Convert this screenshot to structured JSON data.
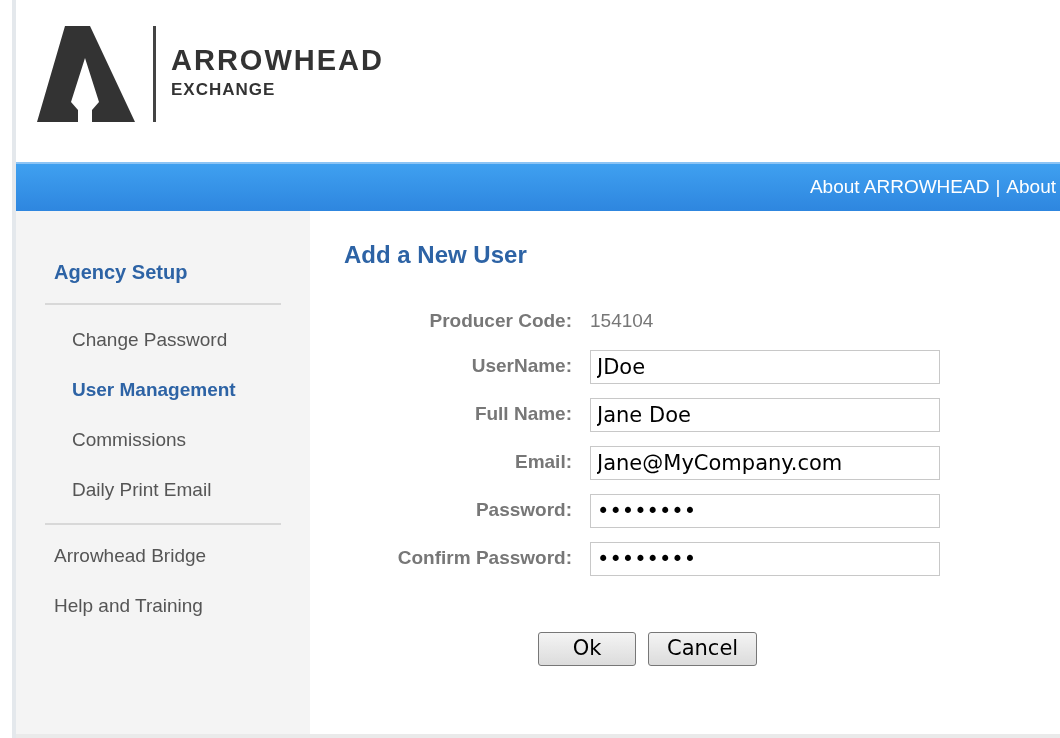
{
  "logo": {
    "name": "ARROWHEAD",
    "subtitle": "EXCHANGE"
  },
  "nav_bar": {
    "links": [
      "About ARROWHEAD",
      "About"
    ],
    "separator": "|"
  },
  "sidebar": {
    "items": [
      {
        "kind": "header",
        "label": "Agency Setup",
        "selected": false
      },
      {
        "kind": "divider"
      },
      {
        "kind": "sub",
        "label": "Change Password",
        "selected": false
      },
      {
        "kind": "sub",
        "label": "User Management",
        "selected": true
      },
      {
        "kind": "sub",
        "label": "Commissions",
        "selected": false
      },
      {
        "kind": "sub",
        "label": "Daily Print Email",
        "selected": false
      },
      {
        "kind": "divider"
      },
      {
        "kind": "top",
        "label": "Arrowhead Bridge",
        "selected": false
      },
      {
        "kind": "top",
        "label": "Help and Training",
        "selected": false
      }
    ]
  },
  "form": {
    "title": "Add a New User",
    "fields": [
      {
        "kind": "static",
        "label": "Producer Code:",
        "value": "154104"
      },
      {
        "kind": "input",
        "label": "UserName:",
        "value": "JDoe"
      },
      {
        "kind": "input",
        "label": "Full Name:",
        "value": "Jane Doe"
      },
      {
        "kind": "input",
        "label": "Email:",
        "value": "Jane@MyCompany.com"
      },
      {
        "kind": "input",
        "label": "Password:",
        "value": "••••••••"
      },
      {
        "kind": "input",
        "label": "Confirm Password:",
        "value": "••••••••"
      }
    ],
    "buttons": [
      "Ok",
      "Cancel"
    ]
  }
}
